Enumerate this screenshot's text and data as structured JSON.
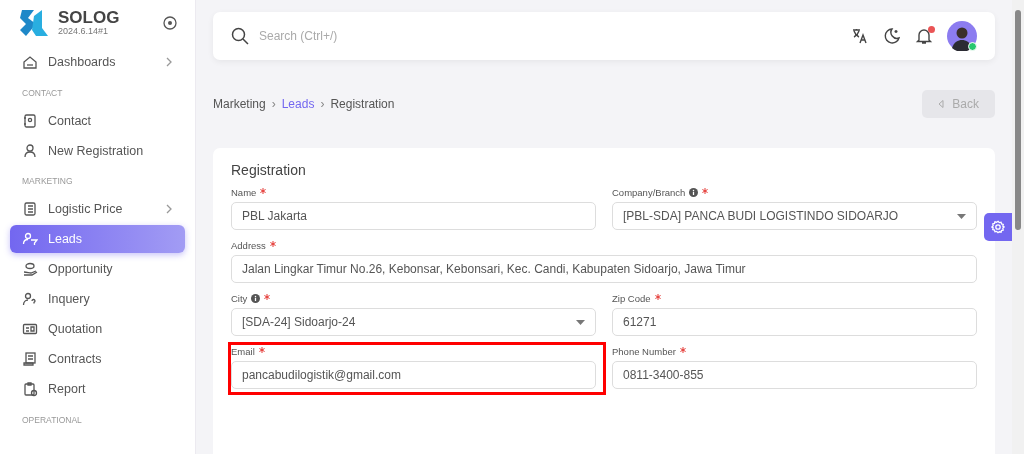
{
  "app": {
    "name": "SOLOG",
    "version": "2024.6.14#1"
  },
  "sidebar": {
    "items": [
      {
        "kind": "item",
        "label": "Dashboards",
        "has_submenu": true,
        "selected": false
      },
      {
        "kind": "section",
        "label": "CONTACT"
      },
      {
        "kind": "item",
        "label": "Contact",
        "has_submenu": false,
        "selected": false
      },
      {
        "kind": "item",
        "label": "New Registration",
        "has_submenu": false,
        "selected": false
      },
      {
        "kind": "section",
        "label": "MARKETING"
      },
      {
        "kind": "item",
        "label": "Logistic Price",
        "has_submenu": true,
        "selected": false
      },
      {
        "kind": "item",
        "label": "Leads",
        "has_submenu": false,
        "selected": true
      },
      {
        "kind": "item",
        "label": "Opportunity",
        "has_submenu": false,
        "selected": false
      },
      {
        "kind": "item",
        "label": "Inquery",
        "has_submenu": false,
        "selected": false
      },
      {
        "kind": "item",
        "label": "Quotation",
        "has_submenu": false,
        "selected": false
      },
      {
        "kind": "item",
        "label": "Contracts",
        "has_submenu": false,
        "selected": false
      },
      {
        "kind": "item",
        "label": "Report",
        "has_submenu": false,
        "selected": false
      },
      {
        "kind": "section",
        "label": "OPERATIONAL"
      }
    ]
  },
  "topbar": {
    "search": {
      "placeholder": "Search (Ctrl+/)"
    },
    "notification_unread": true,
    "user_online": true
  },
  "breadcrumb": [
    {
      "kind": "crumb",
      "label": "Marketing",
      "link": false
    },
    {
      "kind": "separator",
      "label": "›"
    },
    {
      "kind": "crumb",
      "label": "Leads",
      "link": true
    },
    {
      "kind": "separator",
      "label": "›"
    },
    {
      "kind": "crumb",
      "label": "Registration",
      "link": false
    }
  ],
  "back_button": {
    "label": "Back",
    "disabled": true
  },
  "form": {
    "title": "Registration",
    "fields": [
      {
        "label": "Name",
        "kind": "text",
        "required": true,
        "info": false,
        "value": "PBL Jakarta",
        "wide": false,
        "highlighted": false
      },
      {
        "label": "Company/Branch",
        "kind": "select",
        "required": true,
        "info": true,
        "value": "[PBL-SDA] PANCA BUDI LOGISTINDO SIDOARJO",
        "wide": false,
        "highlighted": false
      },
      {
        "label": "Address",
        "kind": "text",
        "required": true,
        "info": false,
        "value": "Jalan Lingkar Timur No.26, Kebonsar, Kebonsari, Kec. Candi, Kabupaten Sidoarjo, Jawa Timur",
        "wide": true,
        "highlighted": false
      },
      {
        "label": "City",
        "kind": "select",
        "required": true,
        "info": true,
        "value": "[SDA-24] Sidoarjo-24",
        "wide": false,
        "highlighted": false
      },
      {
        "label": "Zip Code",
        "kind": "text",
        "required": true,
        "info": false,
        "value": "61271",
        "wide": false,
        "highlighted": false
      },
      {
        "label": "Email",
        "kind": "text",
        "required": true,
        "info": false,
        "value": "pancabudilogistik@gmail.com",
        "wide": false,
        "highlighted": true
      },
      {
        "label": "Phone Number",
        "kind": "text",
        "required": true,
        "info": false,
        "value": "0811-3400-855",
        "wide": false,
        "highlighted": false
      }
    ]
  }
}
